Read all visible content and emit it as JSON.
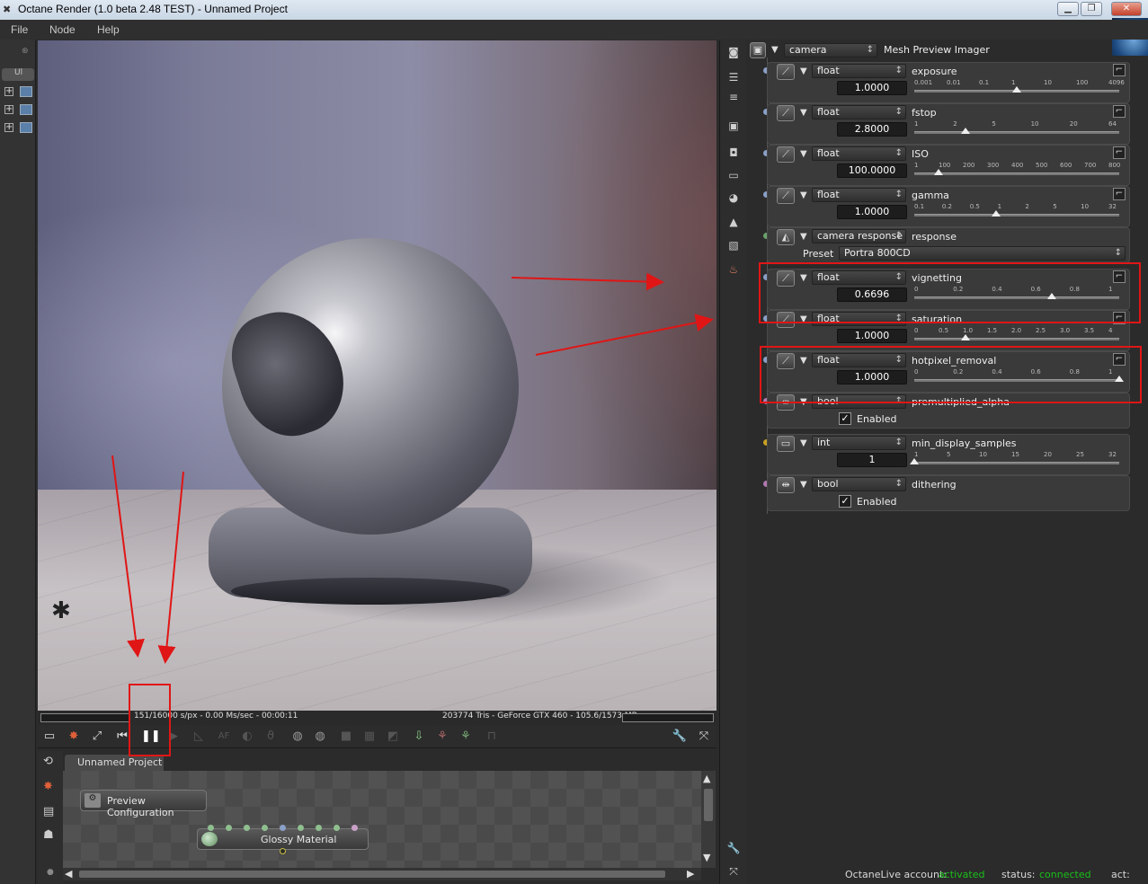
{
  "window": {
    "title": "Octane Render (1.0 beta 2.48 TEST) - Unnamed Project",
    "controls": [
      "minimize-icon",
      "maximize-icon",
      "close-icon"
    ]
  },
  "menu": [
    "File",
    "Node",
    "Help"
  ],
  "left_panel": {
    "tab_label": "Ul",
    "items": [
      "plus-icon",
      "plus-icon",
      "plus-icon"
    ]
  },
  "render_status": {
    "samples": "151/16000 s/px - 0.00 Ms/sec - 00:00:11",
    "scene_info": "203774 Tris - GeForce GTX 460 - 105.6/1573 MB"
  },
  "render_toolbar": {
    "buttons": [
      "clear-icon",
      "reset-icon",
      "fit-icon",
      "restart-icon",
      "pause-icon",
      "play-icon",
      "focus-picker-icon",
      "autofocus-icon",
      "white-balance-icon",
      "material-picker-icon",
      "region-icon",
      "sun-icon",
      "grid-icon",
      "checker-icon",
      "alpha-icon",
      "import-icon",
      "export-icon",
      "tree-icon",
      "lock-icon",
      "settings-icon",
      "fullscreen-icon"
    ],
    "af_label": "AF"
  },
  "node_editor": {
    "tab": "Unnamed Project",
    "nodes": [
      {
        "label": "Preview Configuration"
      },
      {
        "label": "Glossy Material"
      }
    ]
  },
  "inspector": {
    "header_type": "camera",
    "header_name": "Mesh Preview Imager",
    "params": [
      {
        "type": "float",
        "name": "exposure",
        "value": "1.0000",
        "ticks": [
          "0.001",
          "0.01",
          "0.1",
          "1",
          "10",
          "100",
          "4096"
        ],
        "fraction": 0.5,
        "dot": "#8aa0c8"
      },
      {
        "type": "float",
        "name": "fstop",
        "value": "2.8000",
        "ticks": [
          "1",
          "2",
          "5",
          "10",
          "20",
          "64"
        ],
        "fraction": 0.25,
        "dot": "#8aa0c8"
      },
      {
        "type": "float",
        "name": "ISO",
        "value": "100.0000",
        "ticks": [
          "1",
          "100",
          "200",
          "300",
          "400",
          "500",
          "600",
          "700",
          "800"
        ],
        "fraction": 0.12,
        "dot": "#8aa0c8"
      },
      {
        "type": "float",
        "name": "gamma",
        "value": "1.0000",
        "ticks": [
          "0.1",
          "0.2",
          "0.5",
          "1",
          "2",
          "5",
          "10",
          "32"
        ],
        "fraction": 0.4,
        "dot": "#8aa0c8"
      }
    ],
    "response": {
      "type": "camera response",
      "name": "response",
      "preset_label": "Preset",
      "preset_value": "Portra 800CD",
      "dot": "#6aa06a"
    },
    "params2": [
      {
        "type": "float",
        "name": "vignetting",
        "value": "0.6696",
        "ticks": [
          "0",
          "0.2",
          "0.4",
          "0.6",
          "0.8",
          "1"
        ],
        "fraction": 0.6696,
        "dot": "#8aa0c8"
      },
      {
        "type": "float",
        "name": "saturation",
        "value": "1.0000",
        "ticks": [
          "0",
          "0.5",
          "1.0",
          "1.5",
          "2.0",
          "2.5",
          "3.0",
          "3.5",
          "4"
        ],
        "fraction": 0.25,
        "dot": "#8aa0c8"
      },
      {
        "type": "float",
        "name": "hotpixel_removal",
        "value": "1.0000",
        "ticks": [
          "0",
          "0.2",
          "0.4",
          "0.6",
          "0.8",
          "1"
        ],
        "fraction": 1.0,
        "dot": "#8aa0c8"
      }
    ],
    "bool1": {
      "type": "bool",
      "name": "premultiplied_alpha",
      "check_label": "Enabled",
      "dot": "#b07ab0"
    },
    "int1": {
      "type": "int",
      "name": "min_display_samples",
      "value": "1",
      "ticks": [
        "1",
        "5",
        "10",
        "15",
        "20",
        "25",
        "32"
      ],
      "fraction": 0.0,
      "dot": "#c8a020"
    },
    "bool2": {
      "type": "bool",
      "name": "dithering",
      "check_label": "Enabled",
      "dot": "#b07ab0"
    }
  },
  "status": {
    "account_label": "OctaneLive account:",
    "account_value": "activated",
    "status_label": "status:",
    "status_value": "connected",
    "act_label": "act:",
    "ok_color": "#19c019"
  },
  "annotation_color": "#e01515"
}
